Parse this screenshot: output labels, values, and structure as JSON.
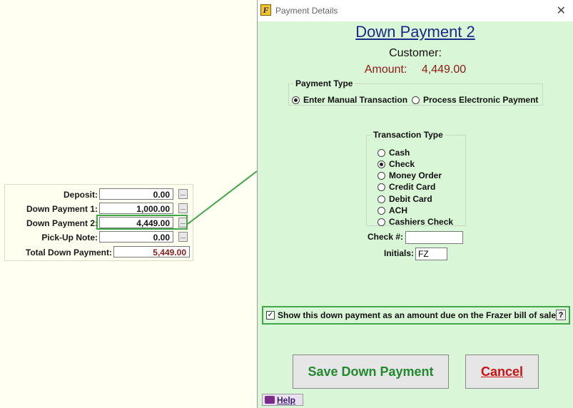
{
  "summary": {
    "rows": [
      {
        "label": "Deposit:",
        "value": "0.00"
      },
      {
        "label": "Down Payment 1:",
        "value": "1,000.00"
      },
      {
        "label": "Down Payment 2:",
        "value": "4,449.00"
      },
      {
        "label": "Pick-Up Note:",
        "value": "0.00"
      }
    ],
    "total_label": "Total Down Payment:",
    "total_value": "5,449.00",
    "ellipsis": "..."
  },
  "dialog": {
    "title": "Payment Details",
    "app_icon": "F",
    "close": "✕",
    "heading": "Down Payment 2",
    "customer_label": "Customer:",
    "amount_label": "Amount:",
    "amount_value": "4,449.00",
    "payment_type": {
      "legend": "Payment Type",
      "options": [
        "Enter Manual Transaction",
        "Process Electronic Payment"
      ],
      "selected": "Enter Manual Transaction"
    },
    "transaction_type": {
      "legend": "Transaction Type",
      "options": [
        "Cash",
        "Check",
        "Money Order",
        "Credit Card",
        "Debit Card",
        "ACH",
        "Cashiers Check"
      ],
      "selected": "Check"
    },
    "check_label": "Check #:",
    "check_value": "",
    "initials_label": "Initials:",
    "initials_value": "FZ",
    "show_due_text": "Show this down payment as an amount due on the Frazer bill of sale.",
    "show_due_checked": true,
    "help_q": "?",
    "save_label": "Save Down Payment",
    "cancel_label": "Cancel",
    "help_label": "Help"
  },
  "colors": {
    "dialog_bg": "#d9f6d6",
    "highlight": "#3fa64a",
    "amount": "#8b1a1a",
    "save": "#1f8a2e",
    "cancel": "#cc1111"
  }
}
